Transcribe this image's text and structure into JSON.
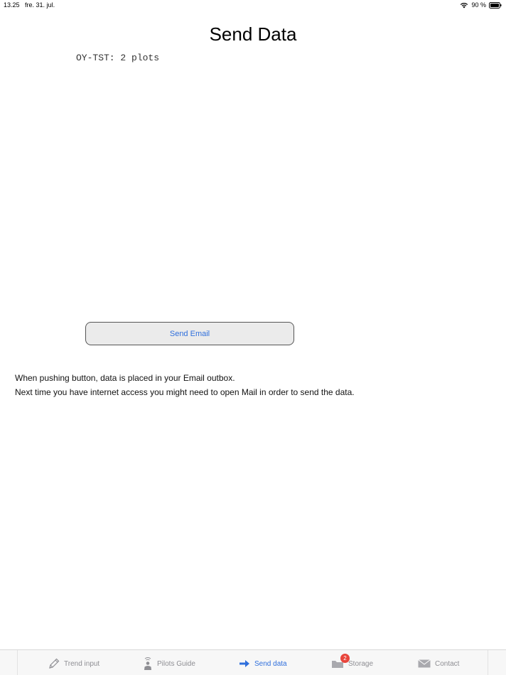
{
  "status_bar": {
    "time": "13.25",
    "date": "fre. 31. jul.",
    "battery": "90 %"
  },
  "title": "Send Data",
  "plots_summary": "OY-TST: 2 plots",
  "send_button_label": "Send Email",
  "info": {
    "line1": "When pushing button, data is placed in your Email outbox.",
    "line2": "Next time you have internet access you might need to open Mail in order to send the data."
  },
  "tabs": [
    {
      "label": "Trend input",
      "icon": "pencil-icon"
    },
    {
      "label": "Pilots Guide",
      "icon": "pilot-icon"
    },
    {
      "label": "Send data",
      "icon": "arrow-right-icon",
      "active": true
    },
    {
      "label": "Storage",
      "icon": "folder-icon",
      "badge": "2"
    },
    {
      "label": "Contact",
      "icon": "envelope-icon"
    }
  ],
  "colors": {
    "accent": "#2f6fdc",
    "inactive_tab": "#8e8e93",
    "badge": "#e8453c"
  }
}
